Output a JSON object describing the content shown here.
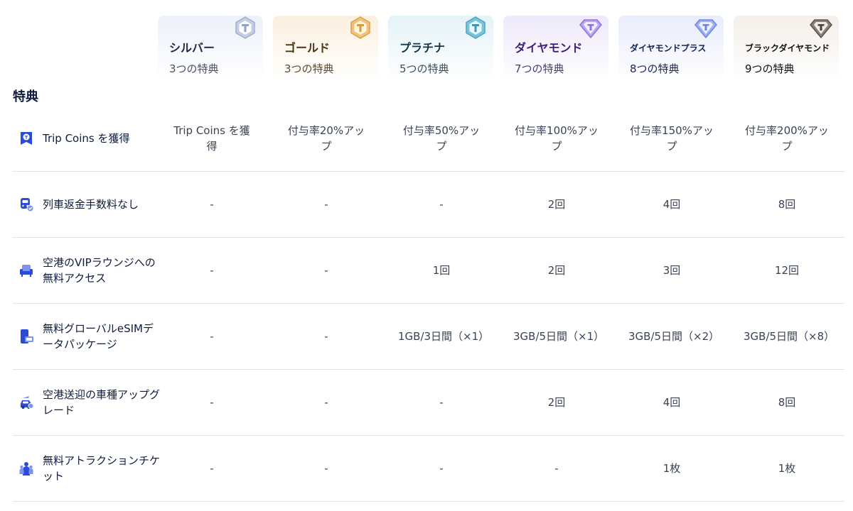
{
  "tiers": [
    {
      "name": "シルバー",
      "count": "3つの特典",
      "icon": "silver-badge-icon",
      "bg_top": "#eef1fa",
      "name_color": "#1f2a44",
      "count_color": "#4a5165",
      "accent": "#b8c4dd"
    },
    {
      "name": "ゴールド",
      "count": "3つの特典",
      "icon": "gold-badge-icon",
      "bg_top": "#fbf0df",
      "name_color": "#4a3412",
      "count_color": "#5c4a2a",
      "accent": "#e3b367"
    },
    {
      "name": "プラチナ",
      "count": "5つの特典",
      "icon": "platinum-badge-icon",
      "bg_top": "#e4f3f8",
      "name_color": "#123447",
      "count_color": "#3a4f5c",
      "accent": "#6fb7cf"
    },
    {
      "name": "ダイヤモンド",
      "count": "7つの特典",
      "icon": "diamond-icon",
      "bg_top": "#eee9fb",
      "name_color": "#3b1f7a",
      "count_color": "#4b3d77",
      "accent": "#a58ee3"
    },
    {
      "name": "ダイヤモンドプラス",
      "count": "8つの特典",
      "icon": "diamond-plus-icon",
      "bg_top": "#e9ecfb",
      "name_color": "#14224f",
      "count_color": "#1b2556",
      "accent": "#8c9ee8"
    },
    {
      "name": "ブラックダイヤモンド",
      "count": "9つの特典",
      "icon": "black-diamond-icon",
      "bg_top": "#f4efe9",
      "name_color": "#111111",
      "count_color": "#111111",
      "accent": "#7a6f6a"
    }
  ],
  "section_title": "特典",
  "rows": [
    {
      "label": "Trip Coins を獲得",
      "icon": "trip-coins-icon",
      "values": [
        "Trip Coins を獲得",
        "付与率20%アップ",
        "付与率50%アップ",
        "付与率100%アップ",
        "付与率150%アップ",
        "付与率200%アップ"
      ]
    },
    {
      "label": "列車返金手数料なし",
      "icon": "train-refund-icon",
      "values": [
        "-",
        "-",
        "-",
        "2回",
        "4回",
        "8回"
      ]
    },
    {
      "label": "空港のVIPラウンジへの無料アクセス",
      "icon": "lounge-seat-icon",
      "values": [
        "-",
        "-",
        "1回",
        "2回",
        "3回",
        "12回"
      ]
    },
    {
      "label": "無料グローバルeSIMデータパッケージ",
      "icon": "esim-icon",
      "values": [
        "-",
        "-",
        "1GB/3日間（×1）",
        "3GB/5日間（×1）",
        "3GB/5日間（×2）",
        "3GB/5日間（×8）"
      ]
    },
    {
      "label": "空港送迎の車種アップグレード",
      "icon": "car-upgrade-icon",
      "values": [
        "-",
        "-",
        "-",
        "2回",
        "4回",
        "8回"
      ]
    },
    {
      "label": "無料アトラクションチケット",
      "icon": "attraction-ticket-icon",
      "values": [
        "-",
        "-",
        "-",
        "-",
        "1枚",
        "1枚"
      ]
    }
  ]
}
